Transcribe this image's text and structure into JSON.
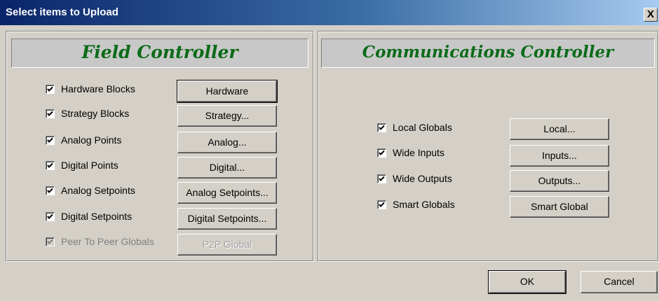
{
  "window": {
    "title": "Select items to Upload",
    "close_label": "X"
  },
  "field": {
    "title": "Field Controller",
    "items": [
      {
        "label": "Hardware Blocks",
        "checked": true,
        "enabled": true,
        "button": "Hardware"
      },
      {
        "label": "Strategy Blocks",
        "checked": true,
        "enabled": true,
        "button": "Strategy..."
      },
      {
        "label": "Analog Points",
        "checked": true,
        "enabled": true,
        "button": "Analog..."
      },
      {
        "label": "Digital Points",
        "checked": true,
        "enabled": true,
        "button": "Digital..."
      },
      {
        "label": "Analog Setpoints",
        "checked": true,
        "enabled": true,
        "button": "Analog Setpoints..."
      },
      {
        "label": "Digital Setpoints",
        "checked": true,
        "enabled": true,
        "button": "Digital Setpoints..."
      },
      {
        "label": "Peer To Peer Globals",
        "checked": true,
        "enabled": false,
        "button": "P2P Global"
      }
    ]
  },
  "comm": {
    "title": "Communications Controller",
    "items": [
      {
        "label": "Local Globals",
        "checked": true,
        "enabled": true,
        "button": "Local..."
      },
      {
        "label": "Wide Inputs",
        "checked": true,
        "enabled": true,
        "button": "Inputs..."
      },
      {
        "label": "Wide Outputs",
        "checked": true,
        "enabled": true,
        "button": "Outputs..."
      },
      {
        "label": "Smart Globals",
        "checked": true,
        "enabled": true,
        "button": "Smart Global"
      }
    ]
  },
  "footer": {
    "ok_label": "OK",
    "cancel_label": "Cancel"
  },
  "colors": {
    "header_text": "#0b6b18",
    "title_bar": "#0a246a"
  }
}
